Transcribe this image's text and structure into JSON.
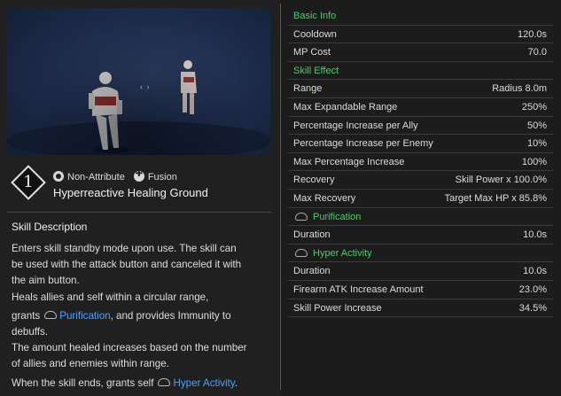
{
  "skill": {
    "number": "1",
    "attribute": "Non-Attribute",
    "type": "Fusion",
    "name": "Hyperreactive Healing Ground"
  },
  "description": {
    "title": "Skill Description",
    "line1": "Enters skill standby mode upon use. The skill can",
    "line2": "be used with the attack button and canceled it with",
    "line3": "the aim button.",
    "line4": "Heals allies and self within a circular range,",
    "line5_pre": "grants",
    "line5_link": "Purification",
    "line5_post": ", and provides Immunity to",
    "line6": "debuffs.",
    "line7": "The amount healed increases based on the number",
    "line8": "of allies and enemies within range.",
    "line9_pre": "When the skill ends, grants self",
    "line9_link": "Hyper Activity",
    "line9_post": "."
  },
  "stats": {
    "basic_info": "Basic Info",
    "cooldown_label": "Cooldown",
    "cooldown_value": "120.0s",
    "mp_label": "MP Cost",
    "mp_value": "70.0",
    "skill_effect": "Skill Effect",
    "range_label": "Range",
    "range_value": "Radius 8.0m",
    "max_range_label": "Max Expandable Range",
    "max_range_value": "250%",
    "ally_label": "Percentage Increase per Ally",
    "ally_value": "50%",
    "enemy_label": "Percentage Increase per Enemy",
    "enemy_value": "10%",
    "max_pct_label": "Max Percentage Increase",
    "max_pct_value": "100%",
    "recovery_label": "Recovery",
    "recovery_value": "Skill Power x 100.0%",
    "max_recovery_label": "Max Recovery",
    "max_recovery_value": "Target Max HP x 85.8%",
    "purification": "Purification",
    "pur_duration_label": "Duration",
    "pur_duration_value": "10.0s",
    "hyper": "Hyper Activity",
    "hyp_duration_label": "Duration",
    "hyp_duration_value": "10.0s",
    "firearm_label": "Firearm ATK Increase Amount",
    "firearm_value": "23.0%",
    "skillpower_label": "Skill Power Increase",
    "skillpower_value": "34.5%"
  },
  "colors": {
    "section_header": "#45d06a",
    "link": "#4aa3ff"
  },
  "icons": {
    "attribute": "non-attribute-icon",
    "type": "fusion-icon",
    "buff": "buff-icon"
  }
}
